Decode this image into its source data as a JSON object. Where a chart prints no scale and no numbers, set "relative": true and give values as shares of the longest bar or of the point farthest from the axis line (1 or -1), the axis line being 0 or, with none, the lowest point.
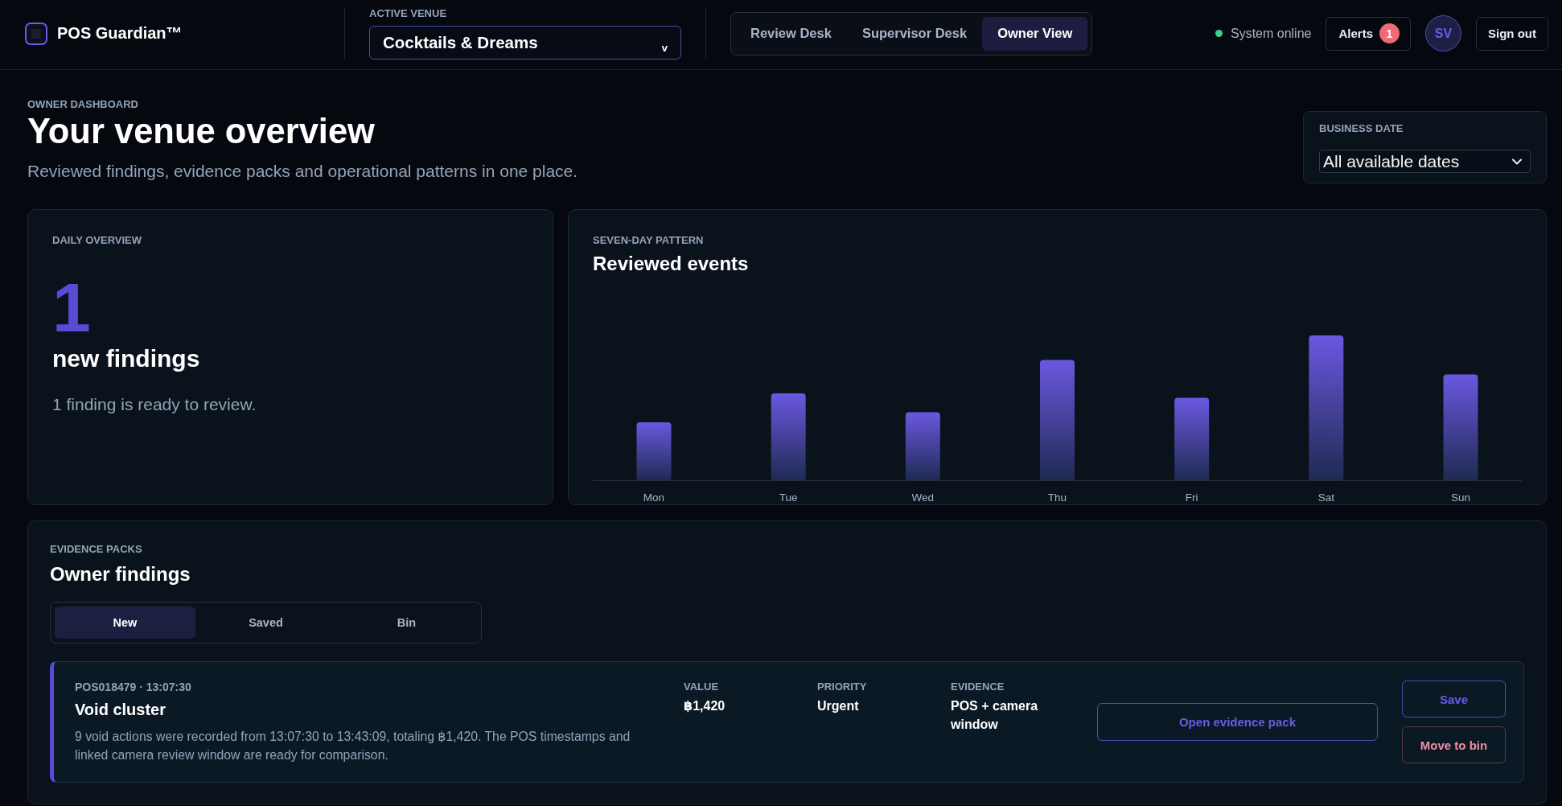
{
  "header": {
    "brand": "POS Guardian™",
    "venue": {
      "label": "ACTIVE VENUE",
      "value": "Cocktails & Dreams",
      "caret": "v"
    },
    "tabs": [
      {
        "label": "Review Desk",
        "selected": false
      },
      {
        "label": "Supervisor Desk",
        "selected": false
      },
      {
        "label": "Owner View",
        "selected": true
      }
    ],
    "status": {
      "label": "System online",
      "online": true
    },
    "alerts": {
      "label": "Alerts",
      "count": "1"
    },
    "avatar": "SV",
    "sign_out": "Sign out"
  },
  "page": {
    "eyebrow": "OWNER DASHBOARD",
    "title": "Your venue overview",
    "subtitle": "Reviewed findings, evidence packs and operational patterns in one place."
  },
  "business_date": {
    "label": "BUSINESS DATE",
    "value": "All available dates"
  },
  "daily_overview": {
    "eyebrow": "DAILY OVERVIEW",
    "count": "1",
    "count_label": "new findings",
    "note": "1 finding is ready to review."
  },
  "pattern": {
    "eyebrow": "SEVEN-DAY PATTERN",
    "title": "Reviewed events",
    "chart_data": {
      "type": "bar",
      "relative": true,
      "categories": [
        "Mon",
        "Tue",
        "Wed",
        "Thu",
        "Fri",
        "Sat",
        "Sun"
      ],
      "values": [
        0.4,
        0.6,
        0.47,
        0.83,
        0.57,
        1,
        0.73
      ]
    }
  },
  "evidence": {
    "eyebrow": "EVIDENCE PACKS",
    "title": "Owner findings",
    "tabs": [
      {
        "label": "New",
        "selected": true
      },
      {
        "label": "Saved",
        "selected": false
      },
      {
        "label": "Bin",
        "selected": false
      }
    ],
    "findings": [
      {
        "meta": "POS018479 · 13:07:30",
        "title": "Void cluster",
        "description": "9 void actions were recorded from 13:07:30 to 13:43:09, totaling ฿1,420. The POS timestamps and linked camera review window are ready for comparison.",
        "fields": [
          {
            "label": "VALUE",
            "value": "฿1,420"
          },
          {
            "label": "PRIORITY",
            "value": "Urgent"
          },
          {
            "label": "EVIDENCE",
            "value": "POS + camera window"
          }
        ],
        "primary_action": "Open evidence pack",
        "actions": [
          {
            "label": "Save",
            "kind": "accent"
          },
          {
            "label": "Move to bin",
            "kind": "danger"
          }
        ]
      }
    ]
  }
}
